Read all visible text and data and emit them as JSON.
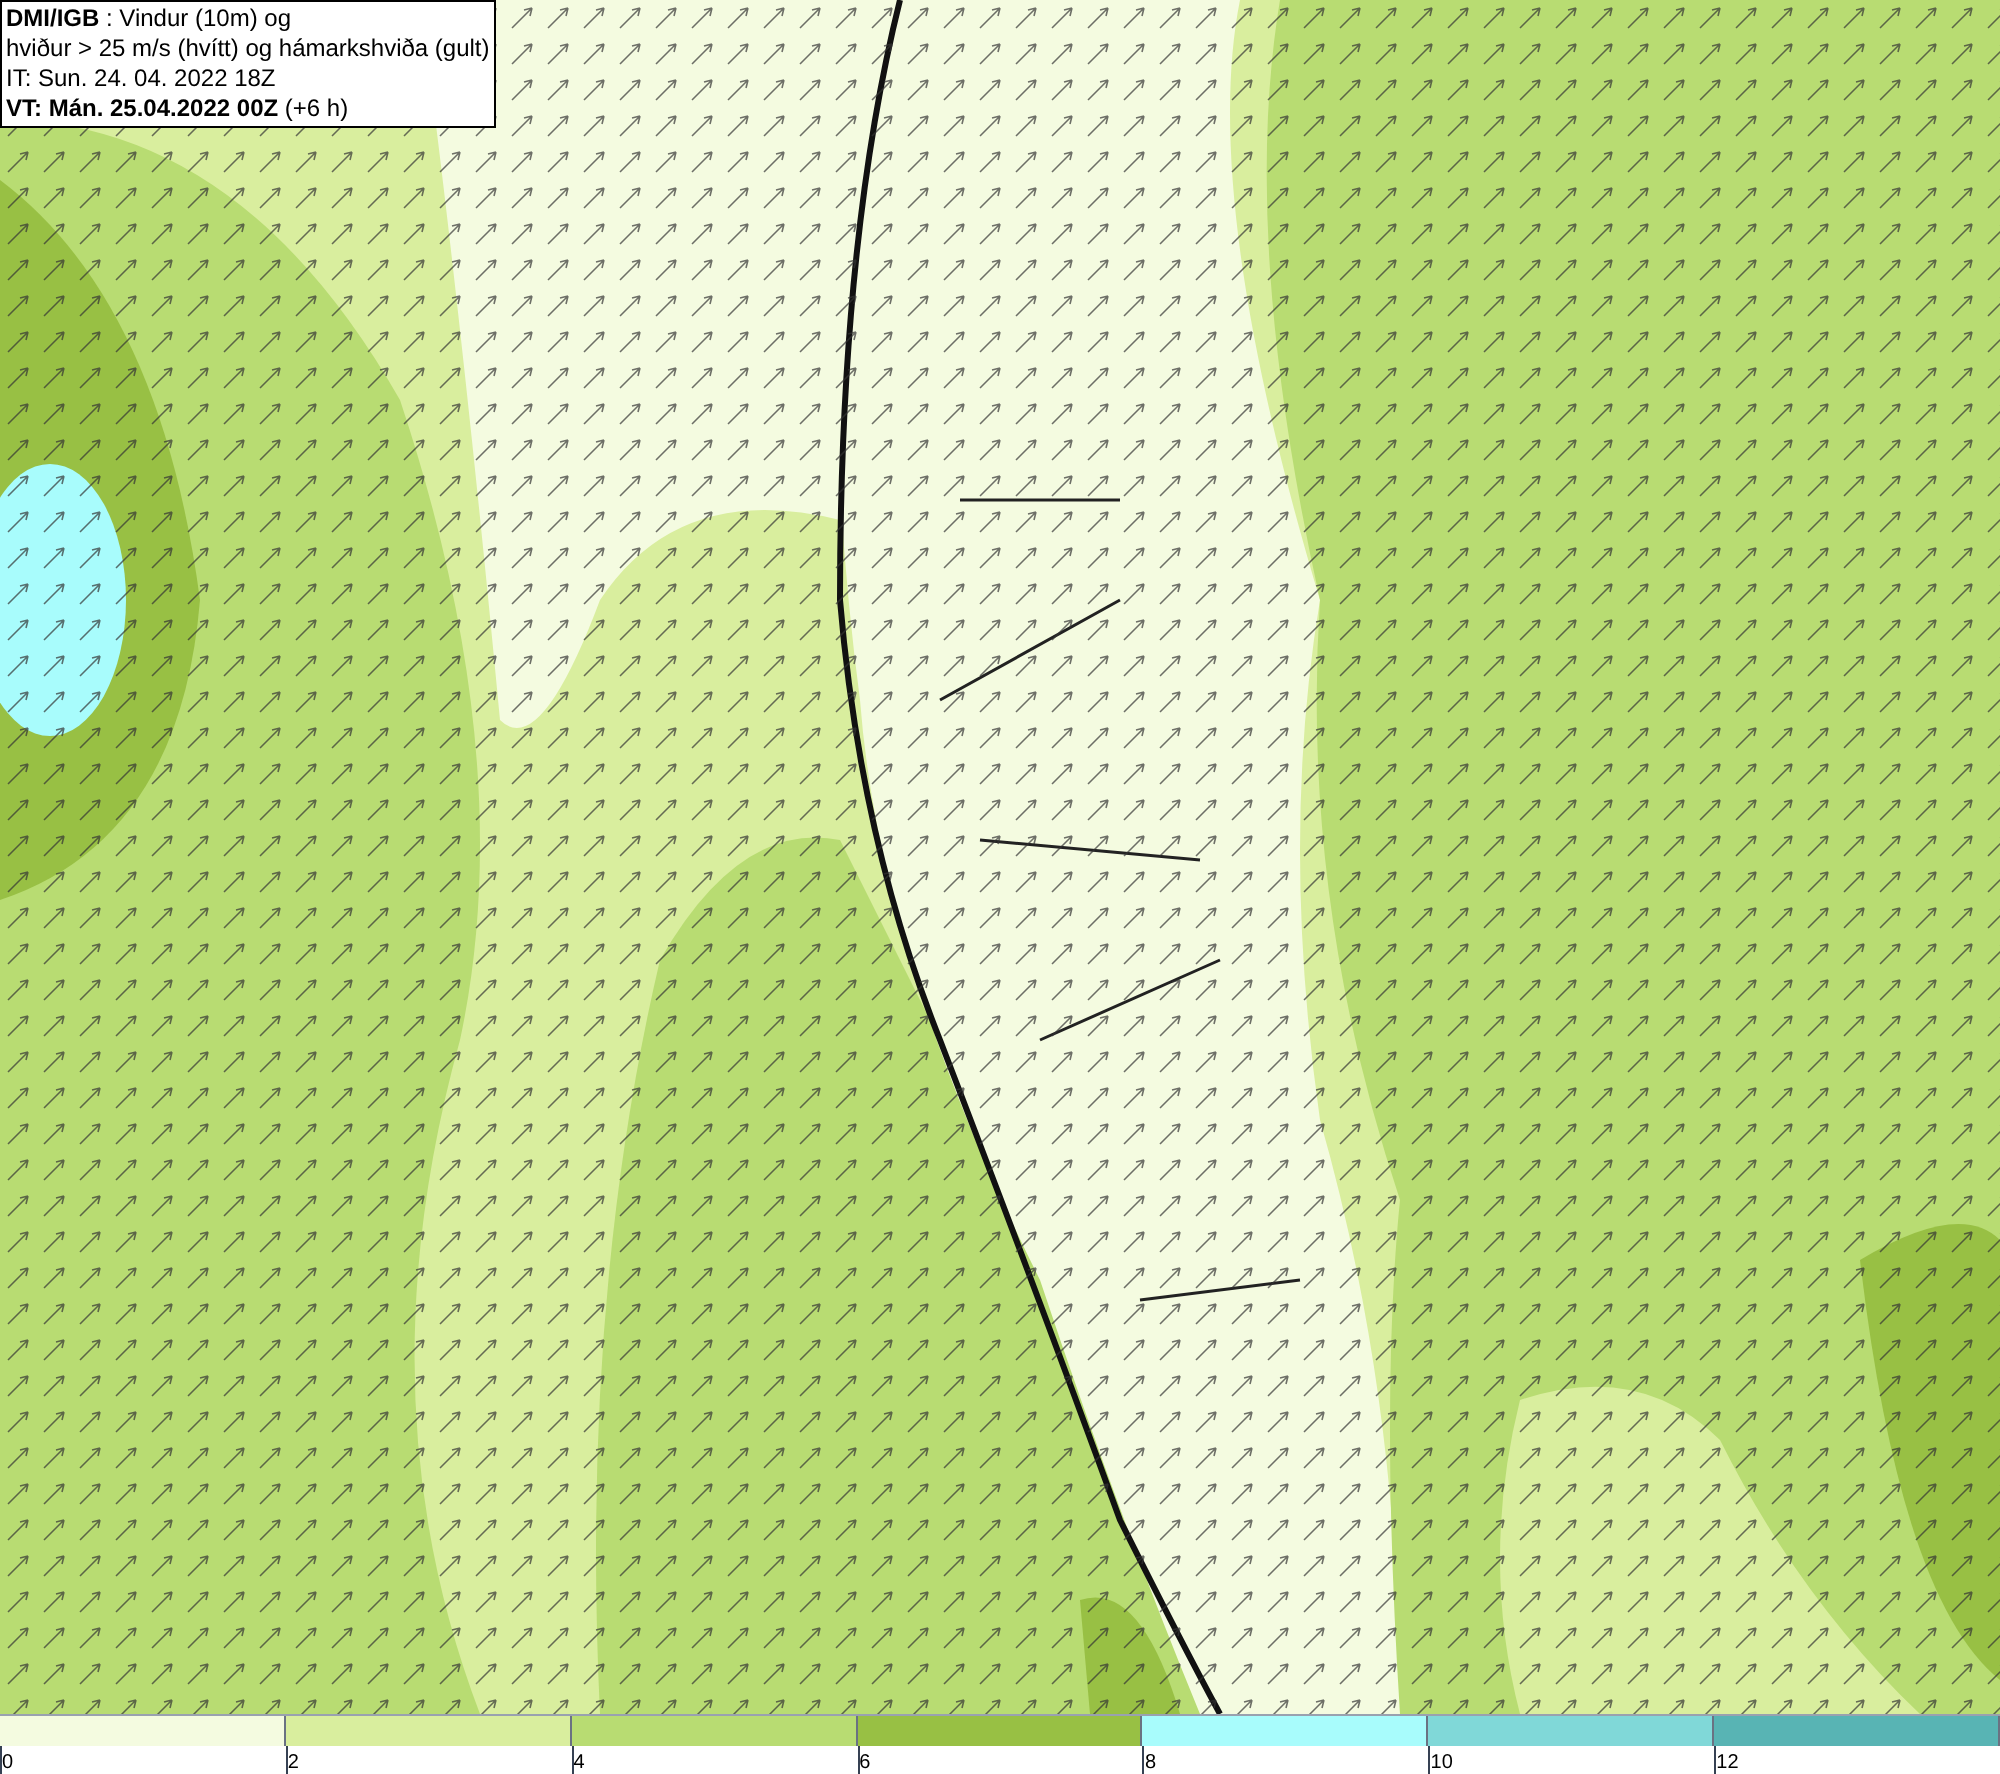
{
  "title_box": {
    "lines": [
      "**DMI/IGB** : Vindur (10m) og",
      "hviður > 25 m/s (hvítt) og hámarkshviða (gult)",
      "IT: Sun. 24. 04. 2022 18Z",
      "**VT: Mán. 25.04.2022 00Z** (+6 h)"
    ]
  },
  "legend": {
    "bins": [
      {
        "label": "0",
        "color": "#f4fbe0"
      },
      {
        "label": "2",
        "color": "#d9ee9e"
      },
      {
        "label": "4",
        "color": "#b8dc72"
      },
      {
        "label": "6",
        "color": "#98c044"
      },
      {
        "label": "8",
        "color": "#a8fcfc"
      },
      {
        "label": "10",
        "color": "#80d8d8"
      },
      {
        "label": "12",
        "color": "#58b4b4"
      }
    ]
  }
}
